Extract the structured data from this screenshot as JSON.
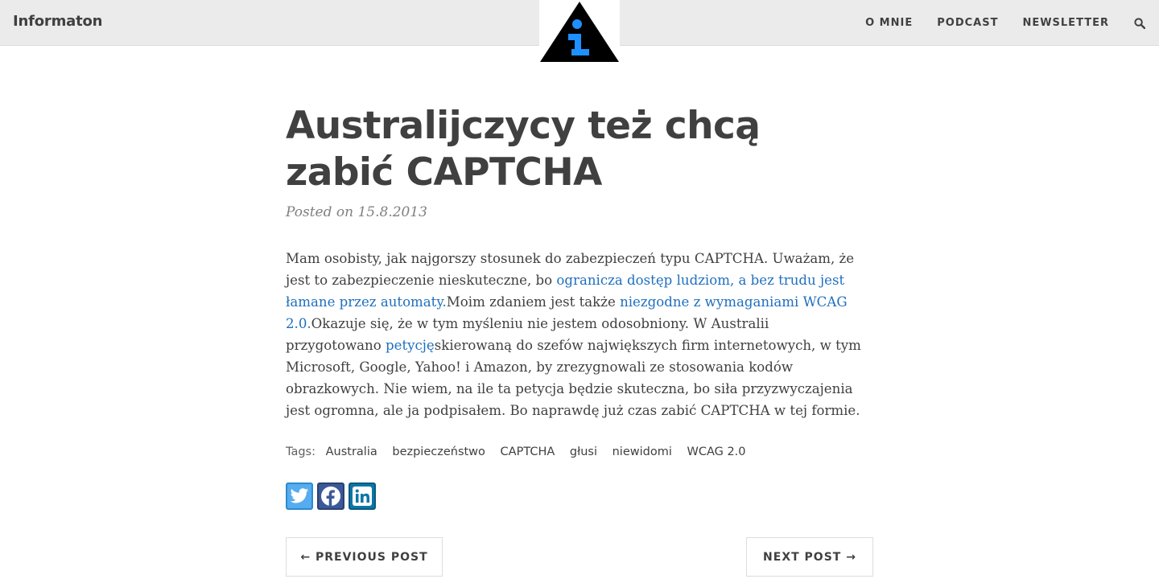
{
  "header": {
    "brand": "Informaton",
    "nav": [
      {
        "label": "O MNIE"
      },
      {
        "label": "PODCAST"
      },
      {
        "label": "NEWSLETTER"
      }
    ],
    "search_icon": "search-icon",
    "logo_icon": "info-triangle-logo-icon",
    "logo_colors": {
      "triangle": "#000000",
      "letter": "#1e90ff"
    }
  },
  "post": {
    "title": "Australijczycy też chcą zabić CAPTCHA",
    "meta": "Posted on 15.8.2013",
    "body": {
      "t1": "Mam osobisty, jak najgorszy stosunek do zabezpieczeń typu CAPTCHA. Uważam, że jest to zabezpieczenie nieskuteczne, bo ",
      "link1": "ogranicza dostęp ludziom, a bez trudu jest łamane przez automaty.",
      "t2": "Moim zdaniem jest także ",
      "link2": "niezgodne z wymaganiami WCAG 2.0.",
      "t3": "Okazuje się, że w tym myśleniu nie jestem odosobniony. W Australii przygotowano ",
      "link3": "petycję",
      "t4": "skierowaną do szefów największych firm internetowych, w tym Microsoft, Google, Yahoo! i Amazon, by zrezygnowali ze stosowania kodów obrazkowych. Nie wiem, na ile ta petycja będzie skuteczna, bo siła przyzwyczajenia jest ogromna, ale ja podpisałem. Bo naprawdę już czas zabić CAPTCHA w tej formie."
    },
    "link_color": "#1f6fbf",
    "tags_label": "Tags:",
    "tags": [
      "Australia",
      "bezpieczeństwo",
      "CAPTCHA",
      "głusi",
      "niewidomi",
      "WCAG 2.0"
    ],
    "share": [
      {
        "icon": "twitter-icon",
        "color": "#55acee"
      },
      {
        "icon": "facebook-icon",
        "color": "#3b5998"
      },
      {
        "icon": "linkedin-icon",
        "color": "#0e76a8"
      }
    ]
  },
  "pager": {
    "prev": "← PREVIOUS POST",
    "next": "NEXT POST →"
  }
}
